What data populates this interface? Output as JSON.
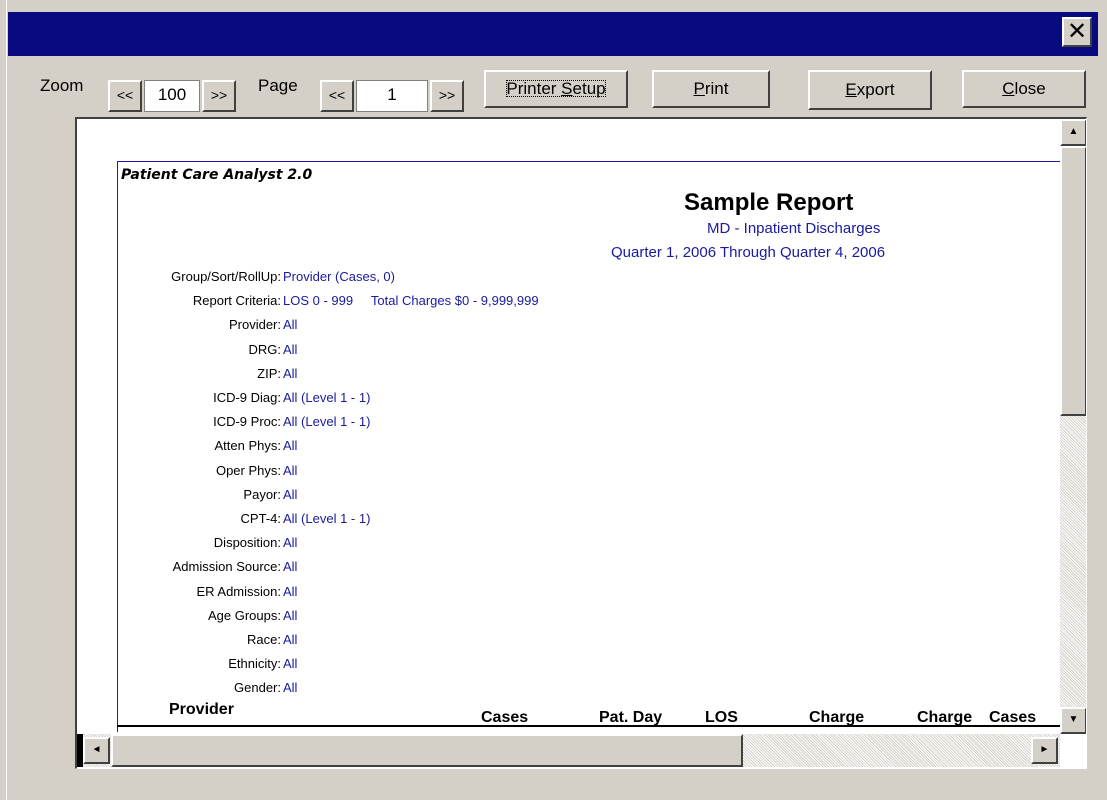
{
  "window": {
    "close_glyph": "✕"
  },
  "toolbar": {
    "zoom_label": "Zoom",
    "zoom_prev": "<<",
    "zoom_value": "100",
    "zoom_next": ">>",
    "page_label": "Page",
    "page_prev": "<<",
    "page_value": "1",
    "page_next": ">>",
    "printer_setup_pre": "Printer ",
    "printer_setup_accel": "S",
    "printer_setup_post": "etup",
    "print_accel": "P",
    "print_rest": "rint",
    "export_accel": "E",
    "export_rest": "xport",
    "close_accel": "C",
    "close_rest": "lose"
  },
  "report": {
    "app_name": "Patient Care Analyst 2.0",
    "title": "Sample Report",
    "subtitle": "MD - Inpatient Discharges",
    "period": "Quarter 1, 2006 Through Quarter 4, 2006",
    "criteria": [
      {
        "label": "Group/Sort/RollUp:",
        "value": "Provider (Cases, 0)"
      },
      {
        "label": "Report Criteria:",
        "value": "LOS 0 - 999     Total Charges $0 - 9,999,999"
      },
      {
        "label": "Provider:",
        "value": "All"
      },
      {
        "label": "DRG:",
        "value": "All"
      },
      {
        "label": "ZIP:",
        "value": "All"
      },
      {
        "label": "ICD-9 Diag:",
        "value": "All (Level 1 - 1)"
      },
      {
        "label": "ICD-9 Proc:",
        "value": "All (Level 1 - 1)"
      },
      {
        "label": "Atten Phys:",
        "value": "All"
      },
      {
        "label": "Oper Phys:",
        "value": "All"
      },
      {
        "label": "Payor:",
        "value": "All"
      },
      {
        "label": "CPT-4:",
        "value": "All (Level 1 - 1)"
      },
      {
        "label": "Disposition:",
        "value": "All"
      },
      {
        "label": "Admission Source:",
        "value": "All"
      },
      {
        "label": "ER Admission:",
        "value": "All"
      },
      {
        "label": "Age Groups:",
        "value": "All"
      },
      {
        "label": "Race:",
        "value": "All"
      },
      {
        "label": "Ethnicity:",
        "value": "All"
      },
      {
        "label": "Gender:",
        "value": "All"
      }
    ],
    "columns": {
      "provider": "Provider",
      "cases": "Cases",
      "pat_day": "Pat. Day",
      "los": "LOS",
      "charge1": "Charge",
      "charge2": "Charge",
      "cases2": "Cases"
    }
  },
  "scrollbars": {
    "up": "▲",
    "down": "▼",
    "left": "◄",
    "right": "►"
  }
}
